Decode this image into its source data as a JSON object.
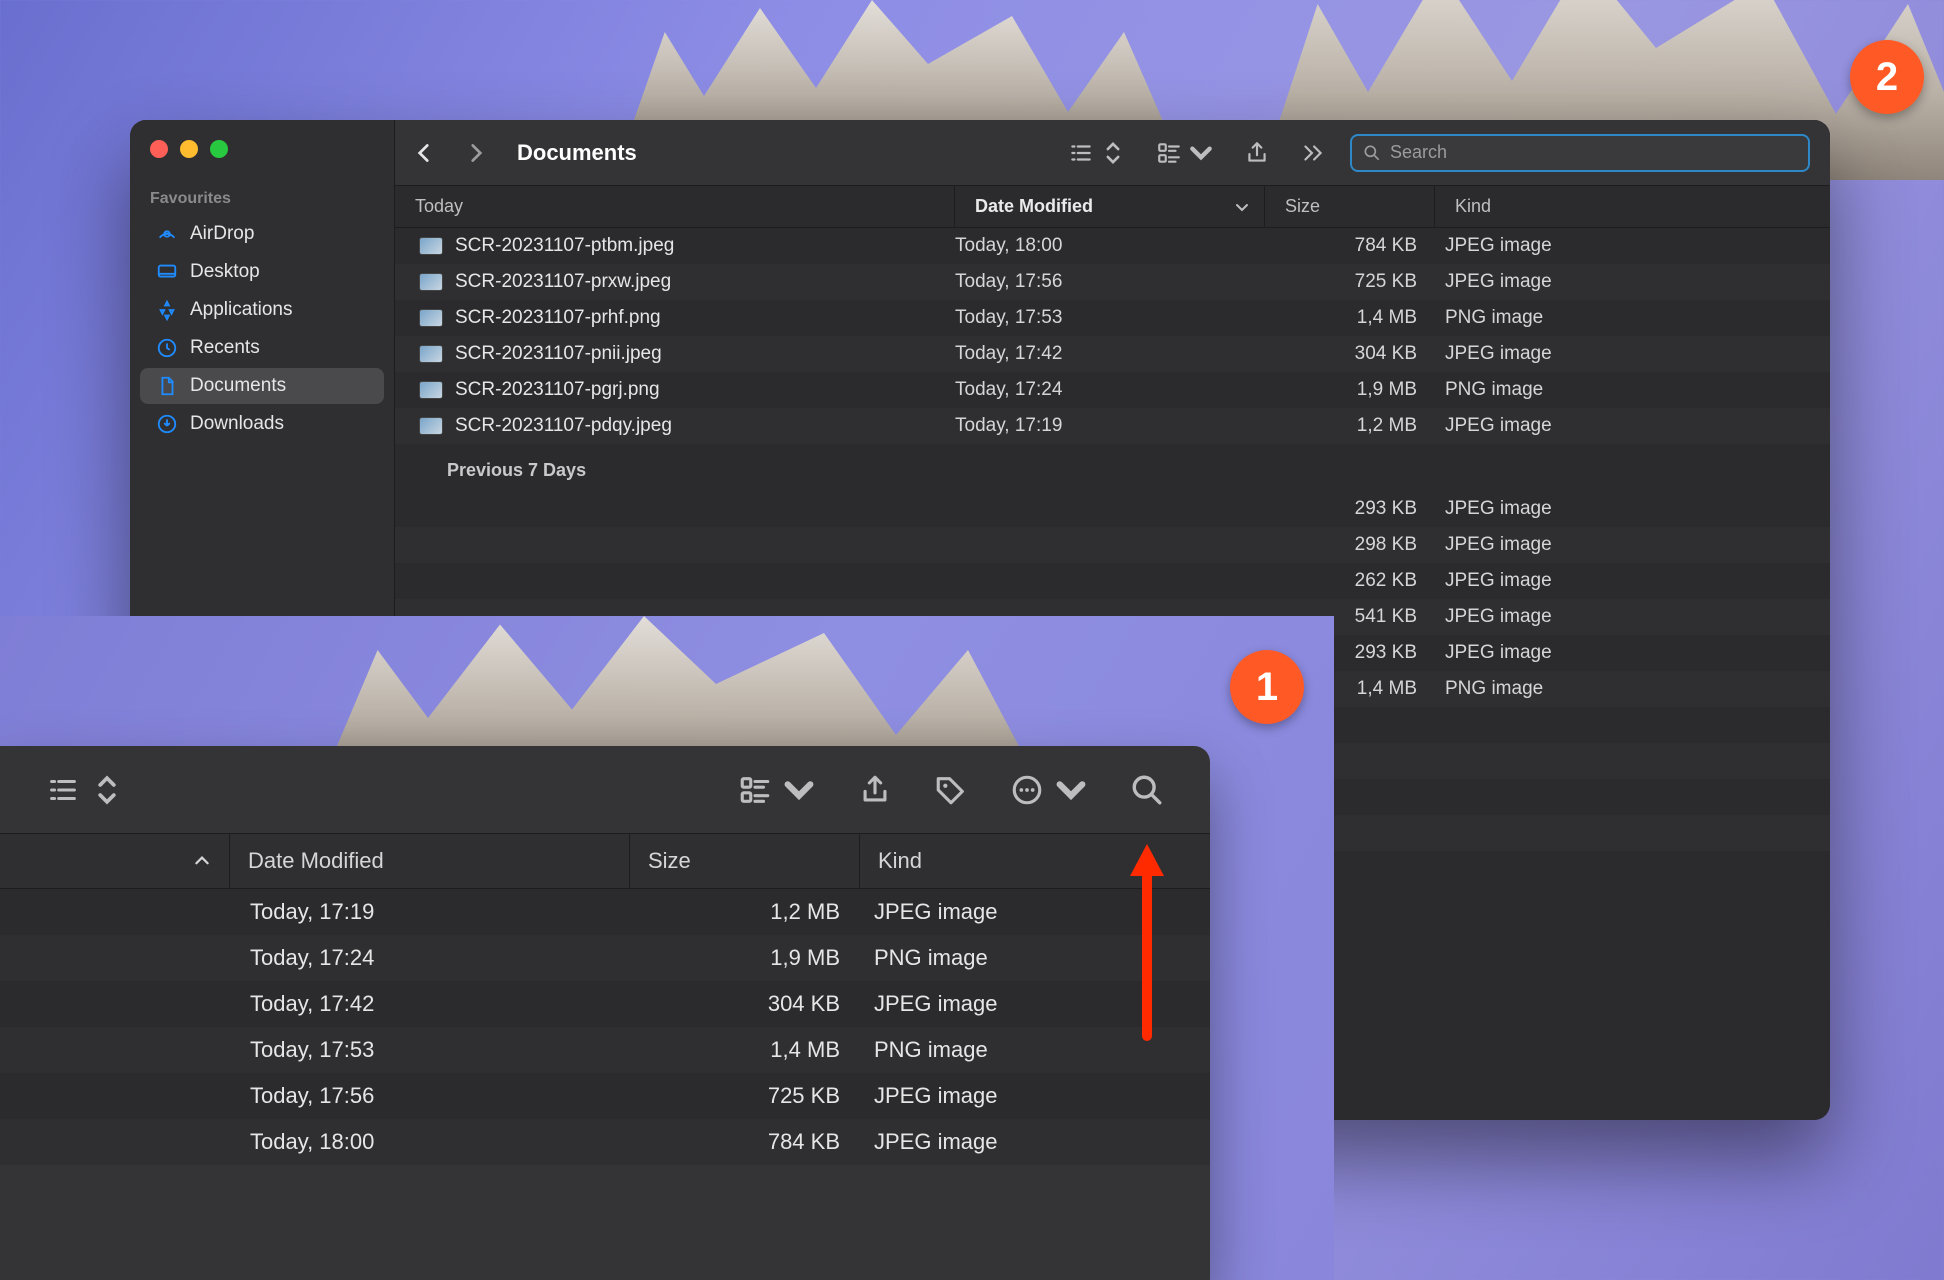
{
  "window": {
    "title": "Documents",
    "search_placeholder": "Search"
  },
  "sidebar": {
    "section": "Favourites",
    "items": [
      {
        "label": "AirDrop"
      },
      {
        "label": "Desktop"
      },
      {
        "label": "Applications"
      },
      {
        "label": "Recents"
      },
      {
        "label": "Documents"
      },
      {
        "label": "Downloads"
      }
    ]
  },
  "columns": {
    "name_group": "Today",
    "date": "Date Modified",
    "size": "Size",
    "kind": "Kind"
  },
  "group2": "Previous 7 Days",
  "files_today": [
    {
      "name": "SCR-20231107-ptbm.jpeg",
      "date": "Today, 18:00",
      "size": "784 KB",
      "kind": "JPEG image"
    },
    {
      "name": "SCR-20231107-prxw.jpeg",
      "date": "Today, 17:56",
      "size": "725 KB",
      "kind": "JPEG image"
    },
    {
      "name": "SCR-20231107-prhf.png",
      "date": "Today, 17:53",
      "size": "1,4 MB",
      "kind": "PNG image"
    },
    {
      "name": "SCR-20231107-pnii.jpeg",
      "date": "Today, 17:42",
      "size": "304 KB",
      "kind": "JPEG image"
    },
    {
      "name": "SCR-20231107-pgrj.png",
      "date": "Today, 17:24",
      "size": "1,9 MB",
      "kind": "PNG image"
    },
    {
      "name": "SCR-20231107-pdqy.jpeg",
      "date": "Today, 17:19",
      "size": "1,2 MB",
      "kind": "JPEG image"
    }
  ],
  "files_prev_partial": [
    {
      "size": "293 KB",
      "kind": "JPEG image"
    },
    {
      "size": "298 KB",
      "kind": "JPEG image"
    },
    {
      "size": "262 KB",
      "kind": "JPEG image"
    },
    {
      "size": "541 KB",
      "kind": "JPEG image"
    },
    {
      "size": "293 KB",
      "kind": "JPEG image"
    },
    {
      "size": "1,4 MB",
      "kind": "PNG image"
    }
  ],
  "inset": {
    "columns": {
      "date": "Date Modified",
      "size": "Size",
      "kind": "Kind"
    },
    "rows": [
      {
        "date": "Today, 17:19",
        "size": "1,2 MB",
        "kind": "JPEG image"
      },
      {
        "date": "Today, 17:24",
        "size": "1,9 MB",
        "kind": "PNG image"
      },
      {
        "date": "Today, 17:42",
        "size": "304 KB",
        "kind": "JPEG image"
      },
      {
        "date": "Today, 17:53",
        "size": "1,4 MB",
        "kind": "PNG image"
      },
      {
        "date": "Today, 17:56",
        "size": "725 KB",
        "kind": "JPEG image"
      },
      {
        "date": "Today, 18:00",
        "size": "784 KB",
        "kind": "JPEG image"
      }
    ]
  },
  "callouts": {
    "one": "1",
    "two": "2"
  }
}
